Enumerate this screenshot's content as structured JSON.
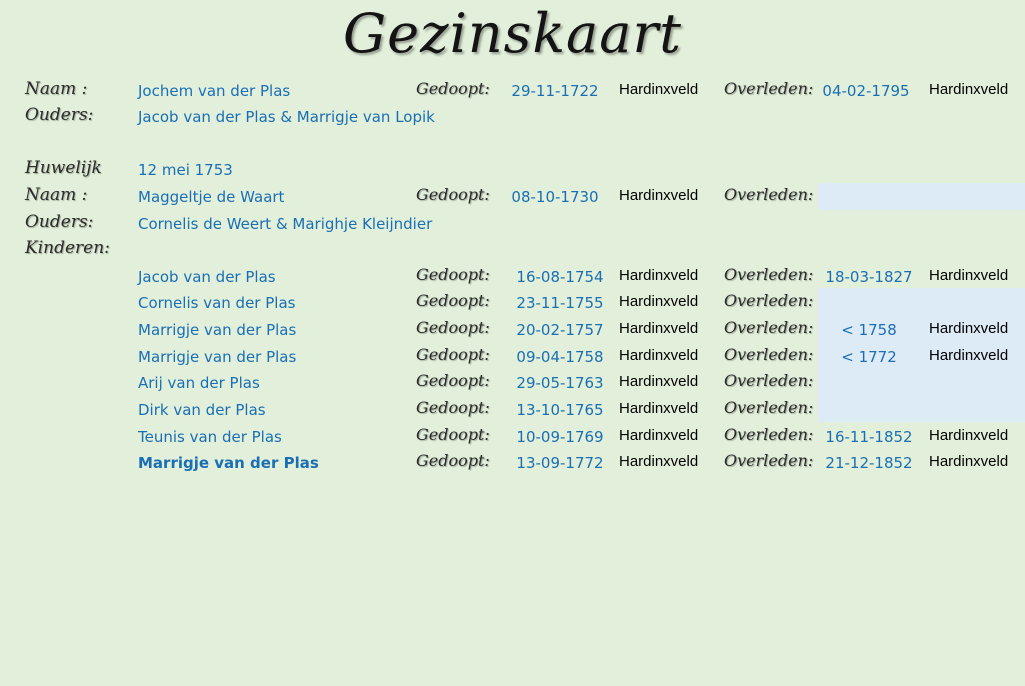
{
  "title": "Gezinskaart",
  "labels": {
    "naam": "Naam :",
    "ouders": "Ouders:",
    "huwelijk": "Huwelijk",
    "kinderen": "Kinderen:",
    "gedoopt": "Gedoopt:",
    "overleden": "Overleden:"
  },
  "husband": {
    "name": "Jochem van der Plas",
    "baptized": "29-11-1722",
    "baptized_place": "Hardinxveld",
    "died": "04-02-1795",
    "died_place": "Hardinxveld",
    "parents": "Jacob van der Plas & Marrigje van Lopik"
  },
  "marriage": "12 mei 1753",
  "wife": {
    "name": "Maggeltje de Waart",
    "baptized": "08-10-1730",
    "baptized_place": "Hardinxveld",
    "died": "",
    "died_place": "",
    "parents": "Cornelis de Weert & Marighje Kleijndier"
  },
  "children": [
    {
      "name": "Jacob van der Plas",
      "baptized": "16-08-1754",
      "baptized_place": "Hardinxveld",
      "died": "18-03-1827",
      "died_place": "Hardinxveld"
    },
    {
      "name": "Cornelis van der Plas",
      "baptized": "23-11-1755",
      "baptized_place": "Hardinxveld",
      "died": "",
      "died_place": ""
    },
    {
      "name": "Marrigje van der Plas",
      "baptized": "20-02-1757",
      "baptized_place": "Hardinxveld",
      "died": "< 1758",
      "died_place": "Hardinxveld"
    },
    {
      "name": "Marrigje van der Plas",
      "baptized": "09-04-1758",
      "baptized_place": "Hardinxveld",
      "died": "< 1772",
      "died_place": "Hardinxveld"
    },
    {
      "name": "Arij van der Plas",
      "baptized": "29-05-1763",
      "baptized_place": "Hardinxveld",
      "died": "",
      "died_place": ""
    },
    {
      "name": "Dirk van der Plas",
      "baptized": "13-10-1765",
      "baptized_place": "Hardinxveld",
      "died": "",
      "died_place": ""
    },
    {
      "name": "Teunis van der Plas",
      "baptized": "10-09-1769",
      "baptized_place": "Hardinxveld",
      "died": "16-11-1852",
      "died_place": "Hardinxveld"
    },
    {
      "name": "Marrigje van der Plas",
      "baptized": "13-09-1772",
      "baptized_place": "Hardinxveld",
      "died": "21-12-1852",
      "died_place": "Hardinxveld"
    }
  ],
  "colors": {
    "background": "#e2efda",
    "highlight": "#ddebf7",
    "name_text": "#1a6fb4",
    "place_text": "#000000"
  }
}
